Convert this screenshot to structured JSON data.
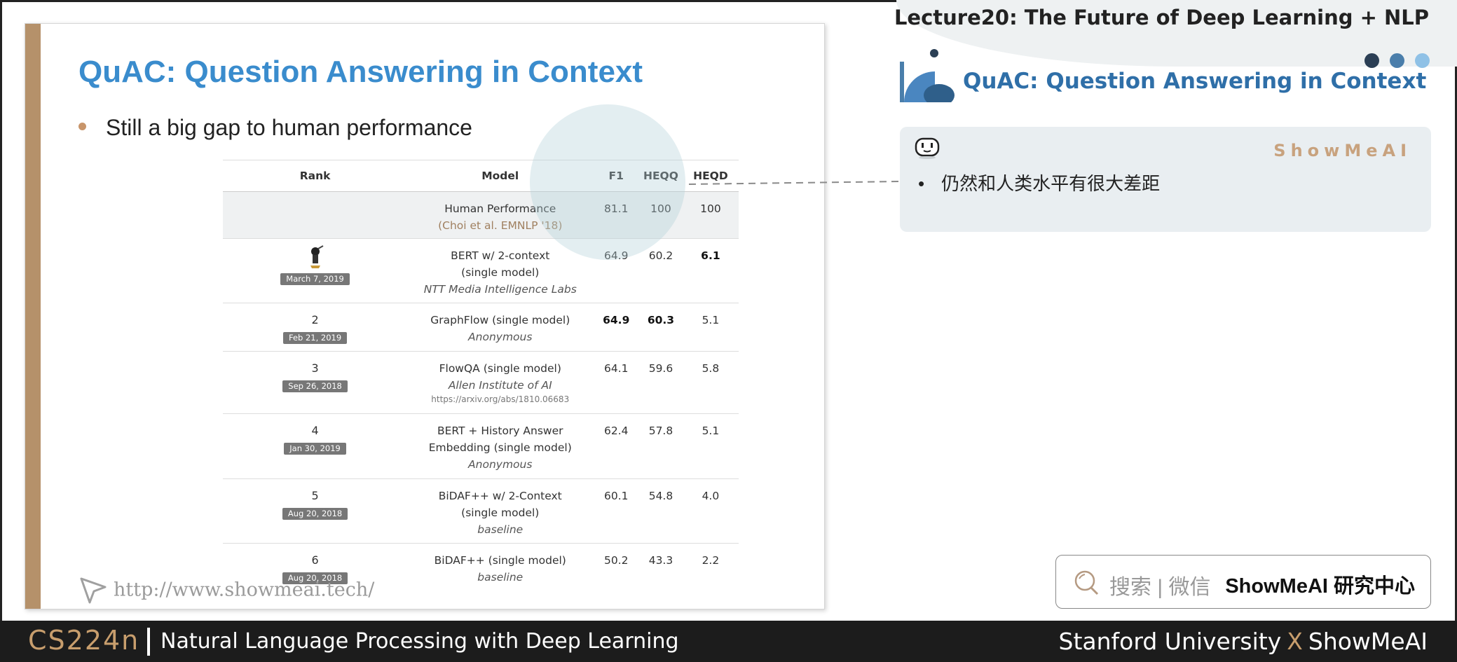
{
  "header": {
    "lecture_title": "Lecture20:  The Future of Deep Learning + NLP"
  },
  "slide": {
    "title": "QuAC: Question Answering in Context",
    "bullet": "Still a big gap to human performance",
    "link": "http://www.showmeai.tech/",
    "table": {
      "headers": [
        "Rank",
        "Model",
        "F1",
        "HEQQ",
        "HEQD"
      ],
      "human": {
        "model": "Human Performance",
        "cite": "(Choi et al. EMNLP '18)",
        "f1": "81.1",
        "heqq": "100",
        "heqd": "100"
      },
      "rows": [
        {
          "rank": "",
          "date": "March 7, 2019",
          "model": "BERT w/ 2-context",
          "model2": "(single model)",
          "org": "NTT Media Intelligence Labs",
          "url": "",
          "f1": "64.9",
          "heqq": "60.2",
          "heqd": "6.1"
        },
        {
          "rank": "2",
          "date": "Feb 21, 2019",
          "model": "GraphFlow (single model)",
          "model2": "",
          "org": "Anonymous",
          "url": "",
          "f1": "64.9",
          "heqq": "60.3",
          "heqd": "5.1"
        },
        {
          "rank": "3",
          "date": "Sep 26, 2018",
          "model": "FlowQA (single model)",
          "model2": "",
          "org": "Allen Institute of AI",
          "url": "https://arxiv.org/abs/1810.06683",
          "f1": "64.1",
          "heqq": "59.6",
          "heqd": "5.8"
        },
        {
          "rank": "4",
          "date": "Jan 30, 2019",
          "model": "BERT + History Answer",
          "model2": "Embedding (single model)",
          "org": "Anonymous",
          "url": "",
          "f1": "62.4",
          "heqq": "57.8",
          "heqd": "5.1"
        },
        {
          "rank": "5",
          "date": "Aug 20, 2018",
          "model": "BiDAF++ w/ 2-Context",
          "model2": "(single model)",
          "org": "baseline",
          "url": "",
          "f1": "60.1",
          "heqq": "54.8",
          "heqd": "4.0"
        },
        {
          "rank": "6",
          "date": "Aug 20, 2018",
          "model": "BiDAF++ (single model)",
          "model2": "",
          "org": "baseline",
          "url": "",
          "f1": "50.2",
          "heqq": "43.3",
          "heqd": "2.2"
        }
      ]
    }
  },
  "notes": {
    "title": "QuAC: Question Answering in Context",
    "brand": "ShowMeAI",
    "bullet_mark": "•",
    "text": "仍然和人类水平有很大差距"
  },
  "search": {
    "text": "搜索 | 微信",
    "brand": "ShowMeAI 研究中心"
  },
  "footer": {
    "course_code": "CS224n",
    "course_name": "Natural Language Processing with Deep Learning",
    "partner_left": "Stanford University",
    "partner_x": "X",
    "partner_right": "ShowMeAI"
  },
  "colors": {
    "accent_blue": "#3a8ccd",
    "accent_brown": "#b5916a",
    "footer_bg": "#1c1c1c"
  }
}
